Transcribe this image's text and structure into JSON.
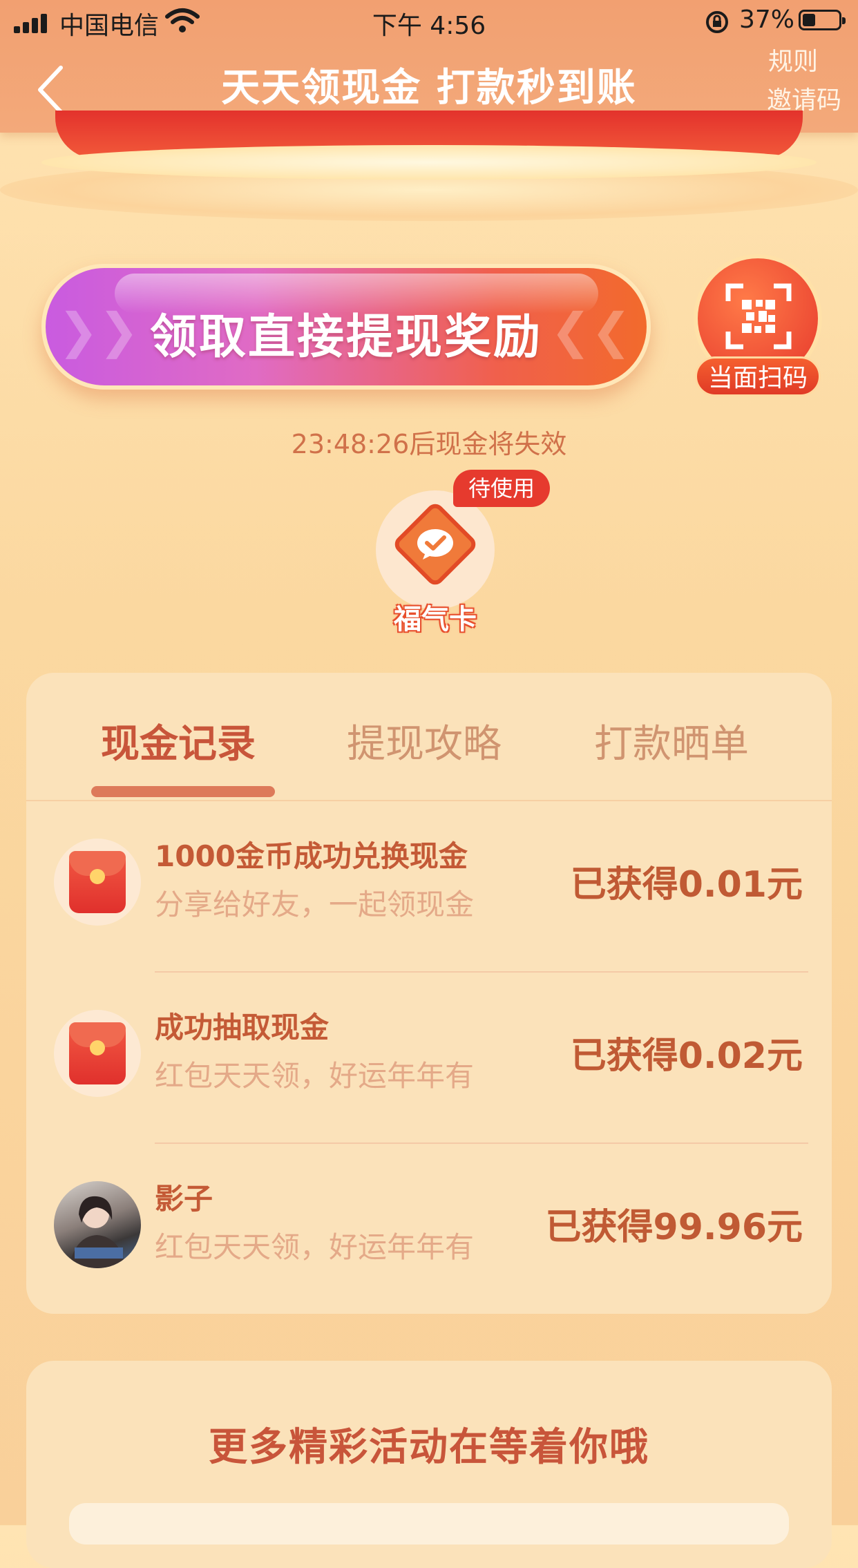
{
  "status_bar": {
    "carrier": "中国电信",
    "time": "下午 4:56",
    "battery_percent": "37%"
  },
  "header": {
    "title": "天天领现金 打款秒到账",
    "rules_link": "规则",
    "invite_link": "邀请码"
  },
  "main": {
    "cta_label": "领取直接提现奖励",
    "scan_label": "当面扫码",
    "countdown": "23:48:26后现金将失效",
    "fortune_card": {
      "label": "福气卡",
      "badge": "待使用"
    }
  },
  "tabs": [
    {
      "label": "现金记录",
      "active": true
    },
    {
      "label": "提现攻略",
      "active": false
    },
    {
      "label": "打款晒单",
      "active": false
    }
  ],
  "records": [
    {
      "icon": "red-envelope-icon",
      "title": "1000金币成功兑换现金",
      "subtitle": "分享给好友，一起领现金",
      "amount": "已获得0.01元"
    },
    {
      "icon": "red-envelope-icon",
      "title": "成功抽取现金",
      "subtitle": "红包天天领，好运年年有",
      "amount": "已获得0.02元"
    },
    {
      "icon": "user-avatar",
      "title": "影子",
      "subtitle": "红包天天领，好运年年有",
      "amount": "已获得99.96元"
    }
  ],
  "more_section": {
    "title": "更多精彩活动在等着你哦"
  },
  "colors": {
    "header_bg": "#f2a071",
    "accent_red": "#e63a2e",
    "text_brown": "#c45a36",
    "card_bg": "#fbe2ba"
  }
}
